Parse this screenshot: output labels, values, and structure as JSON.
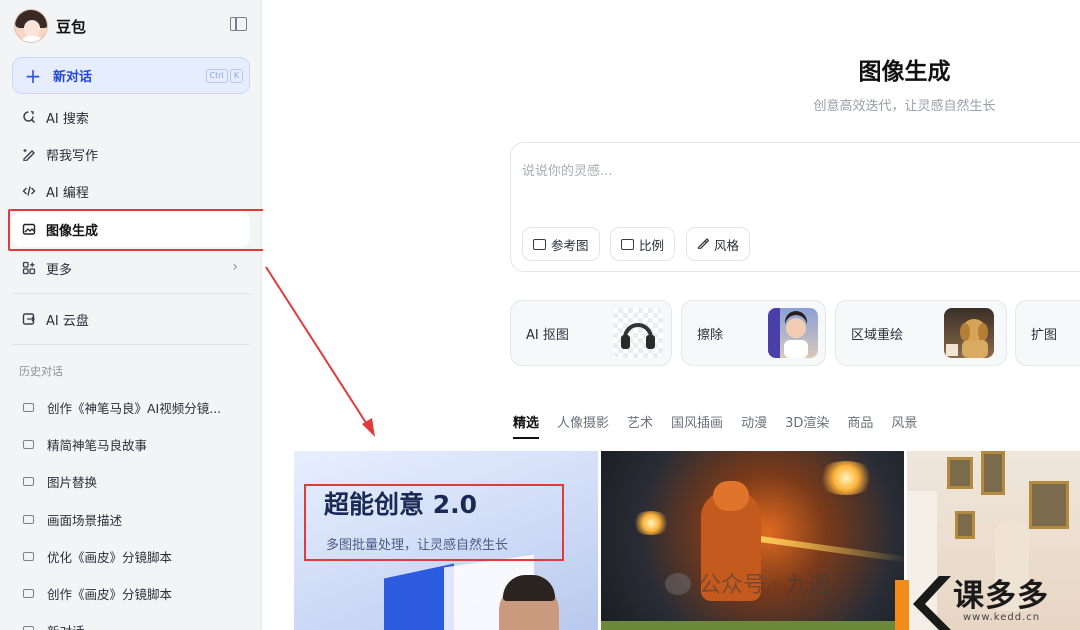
{
  "sidebar": {
    "brand": "豆包",
    "new_chat": {
      "label": "新对话",
      "shortcut": [
        "Ctrl",
        "K"
      ]
    },
    "nav": [
      {
        "label": "AI 搜索",
        "icon": "search-refresh-icon"
      },
      {
        "label": "帮我写作",
        "icon": "pen-sparkle-icon"
      },
      {
        "label": "AI 编程",
        "icon": "code-icon"
      },
      {
        "label": "图像生成",
        "icon": "image-sparkle-icon",
        "active": true
      },
      {
        "label": "更多",
        "icon": "grid-plus-icon",
        "has_chevron": true
      },
      {
        "label": "AI 云盘",
        "icon": "cloud-drive-icon"
      }
    ],
    "history_title": "历史对话",
    "history": [
      "创作《神笔马良》AI视频分镜...",
      "精简神笔马良故事",
      "图片替换",
      "画面场景描述",
      "优化《画皮》分镜脚本",
      "创作《画皮》分镜脚本",
      "新对话"
    ]
  },
  "main": {
    "title": "图像生成",
    "subtitle": "创意高效迭代，让灵感自然生长",
    "prompt": {
      "placeholder": "说说你的灵感...",
      "chips": [
        {
          "label": "参考图",
          "icon": "reference-image-icon"
        },
        {
          "label": "比例",
          "icon": "aspect-ratio-icon"
        },
        {
          "label": "风格",
          "icon": "brush-icon"
        }
      ]
    },
    "tools": [
      "AI 抠图",
      "擦除",
      "区域重绘",
      "扩图"
    ],
    "tabs": [
      "精选",
      "人像摄影",
      "艺术",
      "国风插画",
      "动漫",
      "3D渲染",
      "商品",
      "风景"
    ],
    "active_tab": "精选",
    "feature_card": {
      "title": "超能创意 2.0",
      "subtitle": "多图批量处理，让灵感自然生长"
    }
  },
  "watermark": {
    "text": "公众号 · 九週",
    "logo_text": "课多多",
    "logo_url": "www.kedd.cn"
  },
  "colors": {
    "accent": "#2f54eb",
    "highlight": "#e23a3a",
    "sidebar_bg": "#f3f4f6"
  }
}
